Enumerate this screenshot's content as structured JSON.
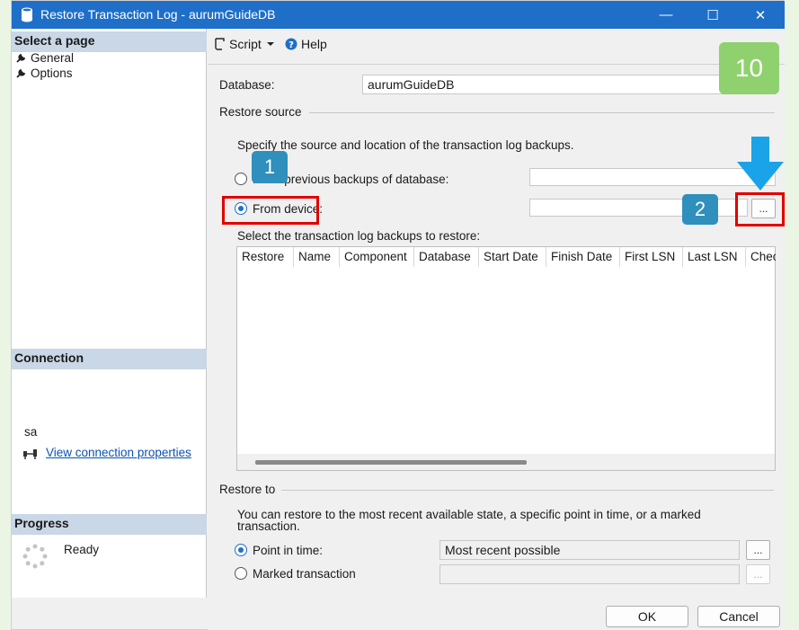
{
  "window": {
    "title": "Restore Transaction Log  -  aurumGuideDB",
    "minimize": "—",
    "maximize": "☐",
    "close": "✕"
  },
  "left_panel": {
    "select_page_header": "Select a page",
    "pages": [
      {
        "label": "General"
      },
      {
        "label": "Options"
      }
    ],
    "connection_header": "Connection",
    "connection_user": "sa",
    "view_connection_link": "View connection properties",
    "progress_header": "Progress",
    "progress_status": "Ready"
  },
  "toolbar": {
    "script_label": "Script",
    "help_label": "Help"
  },
  "general": {
    "database_label": "Database:",
    "database_value": "aurumGuideDB",
    "restore_source_label": "Restore source",
    "source_instruction": "Specify the source and location of the transaction log backups.",
    "option_previous": "From previous backups of database:",
    "option_device": "From device:",
    "ellipsis": "...",
    "select_backups_label": "Select the transaction log backups to restore:",
    "columns": [
      "Restore",
      "Name",
      "Component",
      "Database",
      "Start Date",
      "Finish Date",
      "First LSN",
      "Last LSN",
      "Chec"
    ],
    "restore_to_label": "Restore to",
    "restore_to_instruction": "You can restore to the most recent available state, a specific point in time, or a marked transaction.",
    "point_in_time_label": "Point in time:",
    "point_in_time_value": "Most recent possible",
    "marked_transaction_label": "Marked transaction"
  },
  "buttons": {
    "ok": "OK",
    "cancel": "Cancel"
  },
  "annotations": {
    "step1": "1",
    "step2": "2",
    "page_number": "10"
  },
  "colors": {
    "titlebar": "#1f6fc8",
    "highlight_box": "#e00000",
    "step_badge": "#2f8fbd",
    "page_badge": "#8fd16e",
    "arrow": "#1aa3e8"
  }
}
